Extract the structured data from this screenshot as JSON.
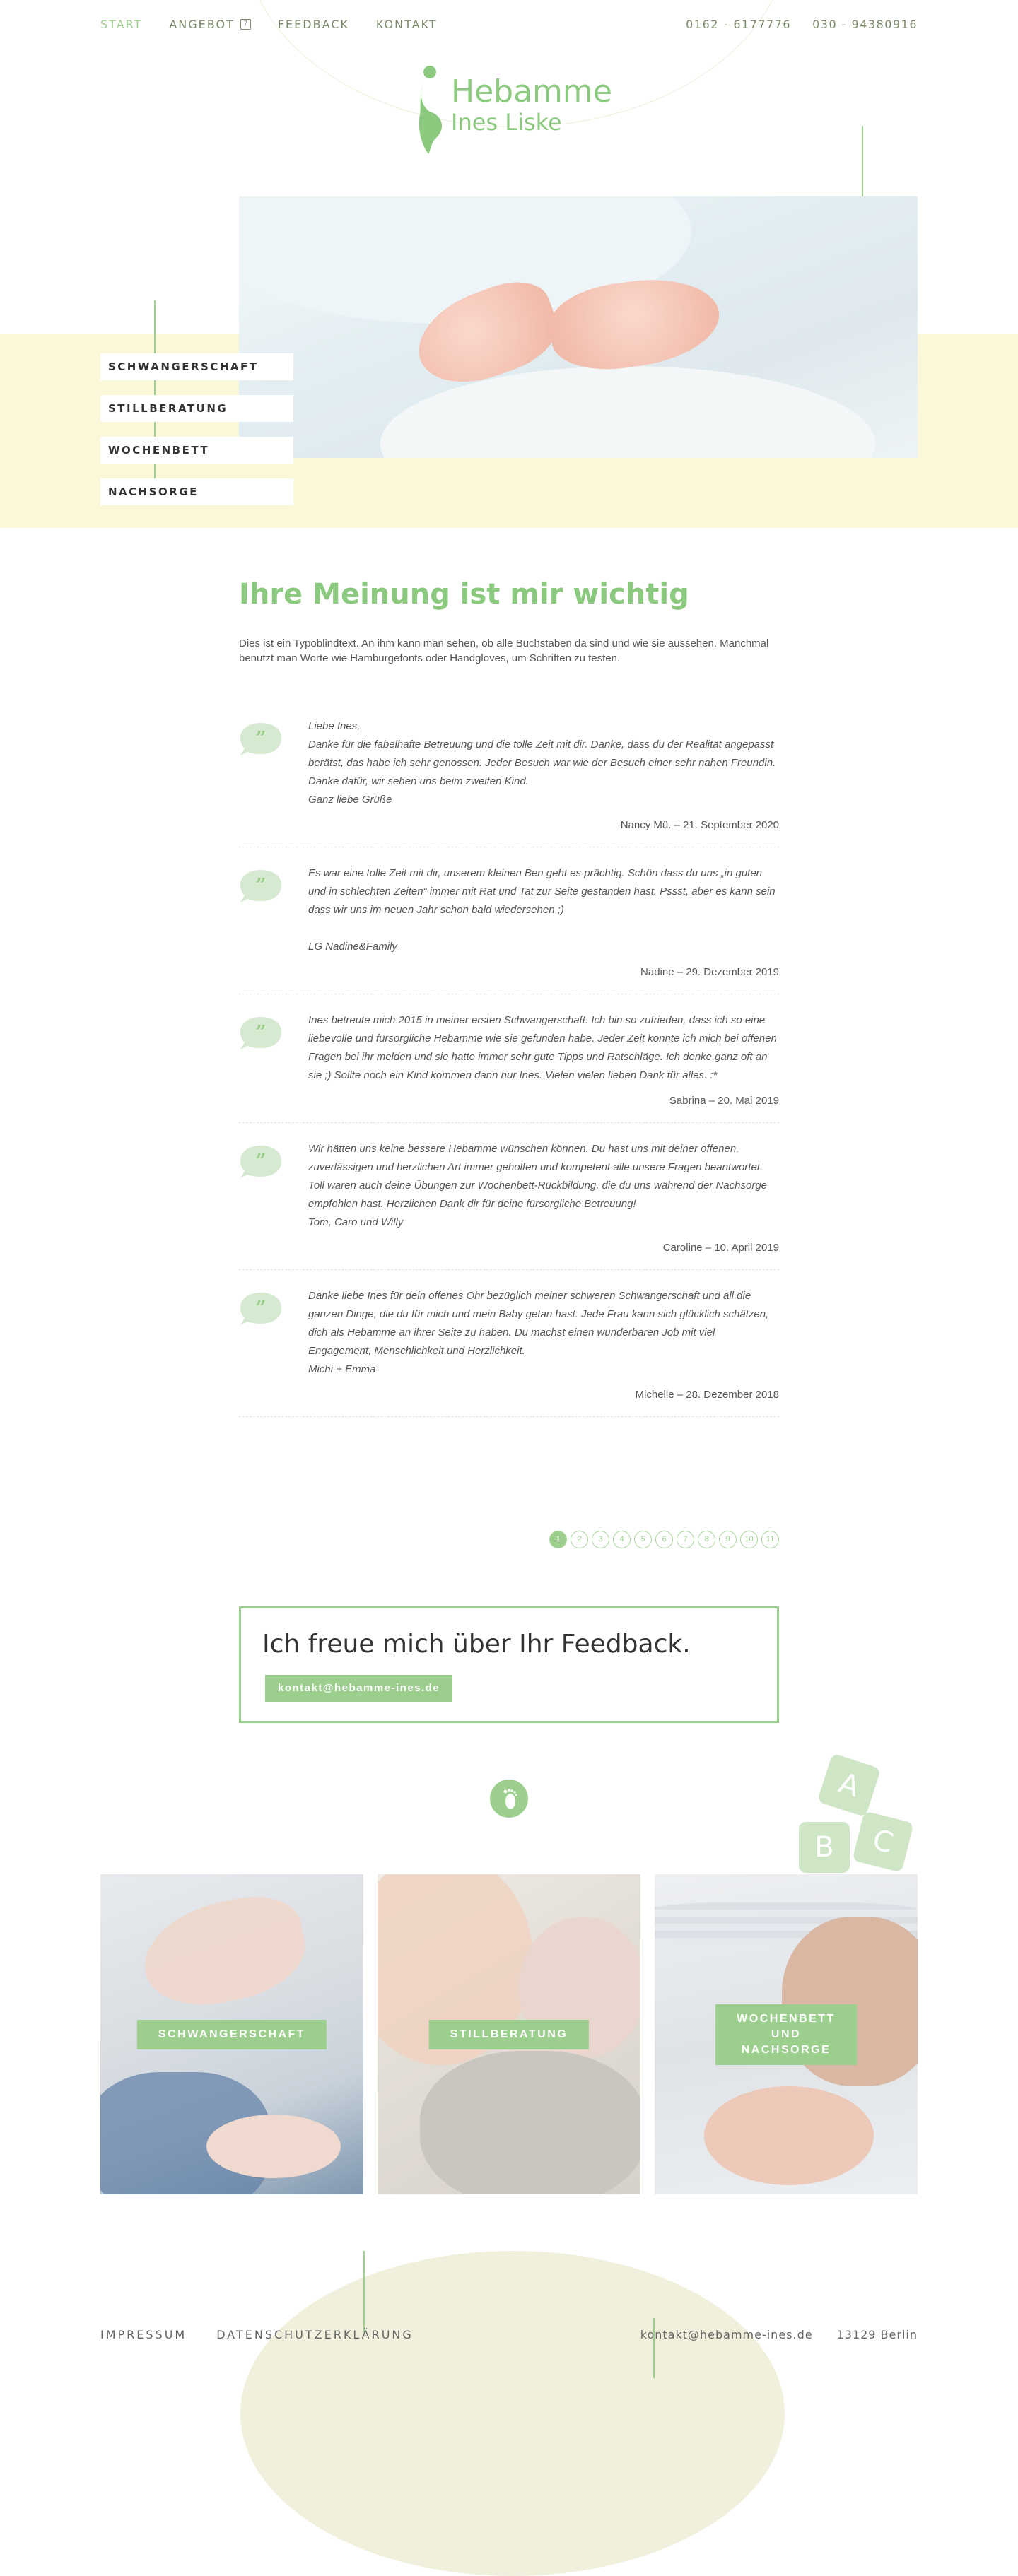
{
  "colors": {
    "accent": "#9ccf8e",
    "highlight_band": "#faf8d9",
    "text": "#555555"
  },
  "nav": {
    "items": [
      {
        "label": "START",
        "active": true
      },
      {
        "label": "ANGEBOT",
        "has_dropdown": true
      },
      {
        "label": "FEEDBACK"
      },
      {
        "label": "KONTAKT"
      }
    ],
    "phones": [
      "0162 - 6177776",
      "030 - 94380916"
    ]
  },
  "logo": {
    "line1": "Hebamme",
    "line2": "Ines Liske",
    "icon": "pregnant-woman-icon"
  },
  "side_menu": [
    "SCHWANGERSCHAFT",
    "STILLBERATUNG",
    "WOCHENBETT",
    "NACHSORGE"
  ],
  "main": {
    "title": "Ihre Meinung ist mir wichtig",
    "intro": "Dies ist ein Typoblindtext. An ihm kann man sehen, ob alle Buchstaben da sind und wie sie aussehen. Manchmal benutzt man Worte wie Hamburgefonts oder Handgloves, um Schriften zu testen."
  },
  "testimonials": [
    {
      "text": "Liebe Ines,\nDanke für die fabelhafte Betreuung und die tolle Zeit mit dir. Danke, dass du der Realität angepasst berätst, das habe ich sehr genossen. Jeder Besuch war wie der Besuch einer sehr nahen Freundin. Danke dafür, wir sehen uns beim zweiten Kind.\nGanz liebe Grüße",
      "meta": "Nancy Mü. – 21. September 2020"
    },
    {
      "text": "Es war eine tolle Zeit mit dir, unserem kleinen Ben geht es prächtig. Schön dass du uns „in guten und in schlechten Zeiten“ immer mit Rat und Tat zur Seite gestanden hast. Pssst, aber es kann sein dass wir uns im neuen Jahr schon bald wiedersehen ;)\n\nLG Nadine&Family",
      "meta": "Nadine – 29. Dezember 2019"
    },
    {
      "text": "Ines betreute mich 2015 in meiner ersten Schwangerschaft. Ich bin so zufrieden, dass ich so eine liebevolle und fürsorgliche Hebamme wie sie gefunden habe. Jeder Zeit konnte ich mich bei offenen Fragen bei ihr melden und sie hatte immer sehr gute Tipps und Ratschläge. Ich denke ganz oft an sie ;) Sollte noch ein Kind kommen dann nur Ines. Vielen vielen lieben Dank für alles. :*",
      "meta": "Sabrina – 20. Mai 2019"
    },
    {
      "text": "Wir hätten uns keine bessere Hebamme wünschen können. Du hast uns mit deiner offenen, zuverlässigen und herzlichen Art immer geholfen und kompetent alle unsere Fragen beantwortet. Toll waren auch deine Übungen zur Wochenbett-Rückbildung, die du uns während der Nachsorge empfohlen hast. Herzlichen Dank dir für deine fürsorgliche Betreuung!\nTom, Caro und Willy",
      "meta": "Caroline – 10. April 2019"
    },
    {
      "text": "Danke liebe Ines für dein offenes Ohr bezüglich meiner schweren Schwangerschaft und all die ganzen Dinge, die du für mich und mein Baby getan hast. Jede Frau kann sich glücklich schätzen, dich als Hebamme an ihrer Seite zu haben. Du machst einen wunderbaren Job mit viel Engagement, Menschlichkeit und Herzlichkeit.\nMichi + Emma",
      "meta": "Michelle – 28. Dezember 2018"
    }
  ],
  "pagination": {
    "pages": [
      "1",
      "2",
      "3",
      "4",
      "5",
      "6",
      "7",
      "8",
      "9",
      "10",
      "11"
    ],
    "current": "1"
  },
  "feedback": {
    "title": "Ich freue mich über Ihr Feedback.",
    "email": "kontakt@hebamme-ines.de"
  },
  "blocks": [
    "A",
    "B",
    "C"
  ],
  "cards": [
    {
      "label": "SCHWANGERSCHAFT",
      "image": "pregnant-belly-photo"
    },
    {
      "label": "STILLBERATUNG",
      "image": "breastfeeding-photo"
    },
    {
      "label": "WOCHENBETT\nUND NACHSORGE",
      "image": "newborn-hand-photo"
    }
  ],
  "footer": {
    "links": [
      "IMPRESSUM",
      "DATENSCHUTZERKLÄRUNG"
    ],
    "email": "kontakt@hebamme-ines.de",
    "city": "13129 Berlin"
  }
}
